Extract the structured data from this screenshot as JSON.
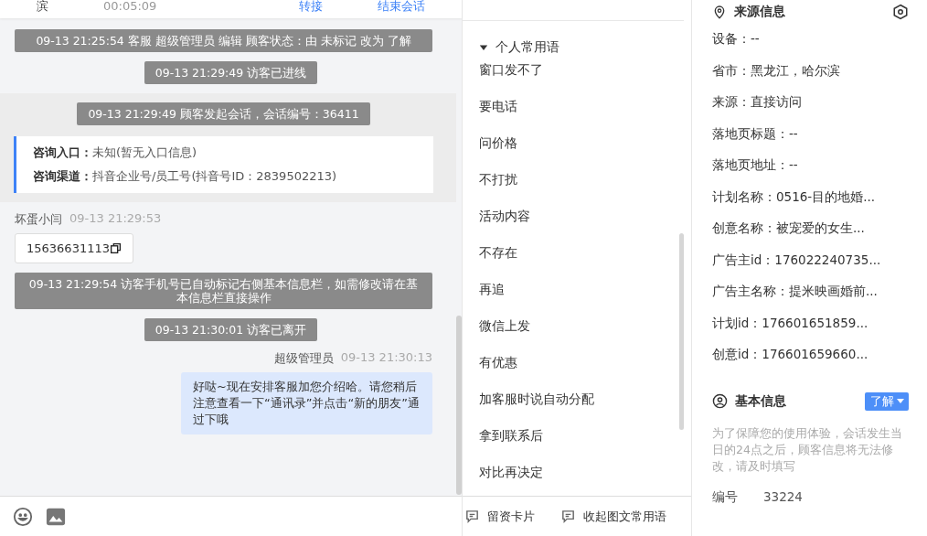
{
  "chat_header": {
    "items": [
      "滨",
      "00:05:09"
    ],
    "actions": [
      "转接",
      "结束会话"
    ]
  },
  "chat": {
    "messages": [
      {
        "kind": "system",
        "text": "09-13 21:25:54 客服 超级管理员 编辑 顾客状态：由 未标记 改为 了解"
      },
      {
        "kind": "system",
        "text": "09-13 21:29:49 访客已进线"
      },
      {
        "kind": "session",
        "text": "09-13 21:29:49 顾客发起会话，会话编号：36411",
        "fields": [
          {
            "label": "咨询入口：",
            "value": "未知(暂无入口信息)"
          },
          {
            "label": "咨询渠道：",
            "value": "抖音企业号/员工号(抖音号ID：2839502213)"
          }
        ]
      },
      {
        "kind": "visitor",
        "name": "坏蛋小闫",
        "time": "09-13 21:29:53",
        "text": "15636631113"
      },
      {
        "kind": "system",
        "text": "09-13 21:29:54 访客手机号已自动标记右侧基本信息栏，如需修改请在基本信息栏直接操作"
      },
      {
        "kind": "system",
        "text": "09-13 21:30:01 访客已离开"
      },
      {
        "kind": "agent",
        "name": "超级管理员",
        "time": "09-13 21:30:13",
        "text": "好哒~现在安排客服加您介绍哈。请您稍后注意查看一下“通讯录”并点击“新的朋友”通过下哦"
      }
    ]
  },
  "phrases": {
    "group": {
      "title": "个人常用语",
      "expanded": true
    },
    "items": [
      "窗口发不了",
      "要电话",
      "问价格",
      "不打扰",
      "活动内容",
      "不存在",
      "再追",
      "微信上发",
      "有优惠",
      "加客服时说自动分配",
      "拿到联系后",
      "对比再决定"
    ],
    "footer": [
      "留资卡片",
      "收起图文常用语"
    ]
  },
  "source_info": {
    "title": "来源信息",
    "rows": [
      "设备：--",
      "省市：黑龙江，哈尔滨",
      "来源：直接访问",
      "落地页标题：--",
      "落地页地址：--",
      "计划名称：0516-目的地婚...",
      "创意名称：被宠爱的女生...",
      "广告主id：176022240735...",
      "广告主名称：提米映画婚前...",
      "计划id：176601651859...",
      "创意id：176601659660..."
    ]
  },
  "basic_info": {
    "title": "基本信息",
    "status": "了解",
    "note": "为了保障您的使用体验，会话发生当日的24点之后，顾客信息将无法修改，请及时填写",
    "fields": [
      {
        "label": "编号",
        "value": "33224"
      }
    ]
  }
}
